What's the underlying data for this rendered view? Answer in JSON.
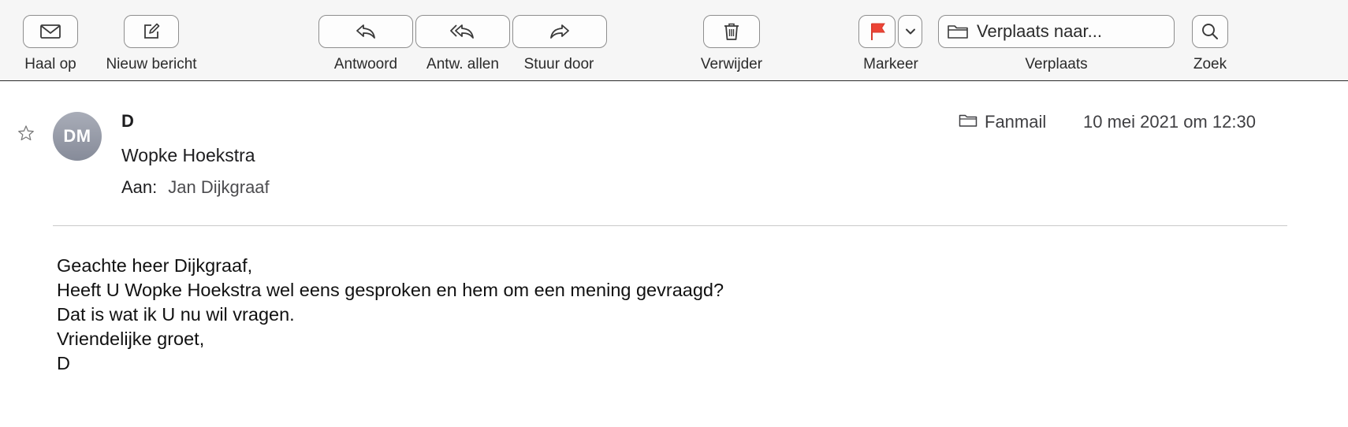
{
  "toolbar": {
    "get_mail": {
      "label": "Haal op",
      "icon": "envelope-icon"
    },
    "new_message": {
      "label": "Nieuw bericht",
      "icon": "compose-icon"
    },
    "reply": {
      "label": "Antwoord",
      "icon": "reply-icon"
    },
    "reply_all": {
      "label": "Antw. allen",
      "icon": "reply-all-icon"
    },
    "forward": {
      "label": "Stuur door",
      "icon": "forward-icon"
    },
    "delete": {
      "label": "Verwijder",
      "icon": "trash-icon"
    },
    "flag": {
      "label": "Markeer",
      "icon": "flag-icon",
      "color": "#ec4436"
    },
    "move": {
      "label": "Verplaats",
      "button_text": "Verplaats naar...",
      "icon": "folder-icon"
    },
    "search": {
      "label": "Zoek",
      "icon": "search-icon"
    }
  },
  "message": {
    "avatar_initials": "DM",
    "from": "D",
    "subject": "Wopke Hoekstra",
    "to_label": "Aan:",
    "to": "Jan Dijkgraaf",
    "mailbox": "Fanmail",
    "date": "10 mei 2021 om 12:30",
    "body": [
      "Geachte heer Dijkgraaf,",
      "Heeft U Wopke Hoekstra wel eens gesproken en hem om een mening gevraagd?",
      "Dat is wat ik U nu wil vragen.",
      "Vriendelijke groet,",
      "D"
    ]
  }
}
